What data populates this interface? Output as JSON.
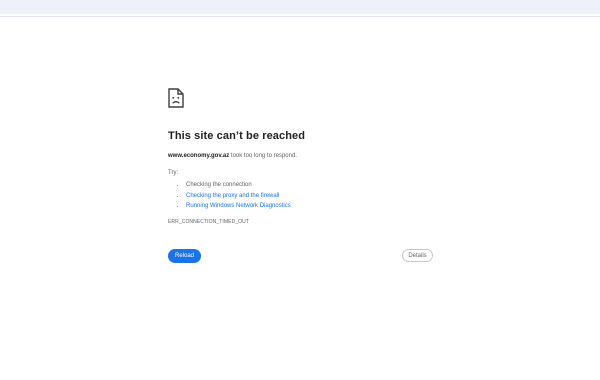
{
  "error_page": {
    "icon": "sad-page-icon",
    "title": "This site can’t be reached",
    "domain": "www.economy.gov.az",
    "description_suffix": " took too long to respond.",
    "try_label": "Try:",
    "suggestions": [
      {
        "text": "Checking the connection",
        "is_link": false
      },
      {
        "text": "Checking the proxy and the firewall",
        "is_link": true
      },
      {
        "text": "Running Windows Network Diagnostics",
        "is_link": true
      }
    ],
    "error_code": "ERR_CONNECTION_TIMED_OUT",
    "reload_label": "Reload",
    "details_label": "Details"
  },
  "colors": {
    "accent": "#1a73e8",
    "text": "#202124",
    "secondary_text": "#5f6368",
    "top_bar": "#eef1fa"
  }
}
